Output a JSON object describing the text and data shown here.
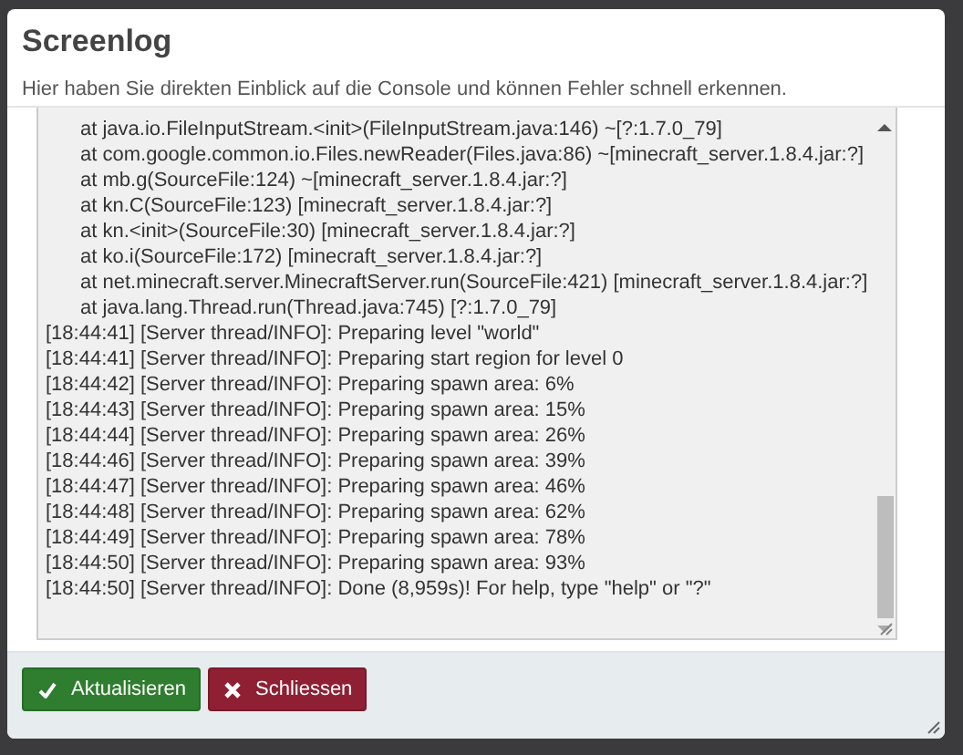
{
  "dialog": {
    "title": "Screenlog",
    "description": "Hier haben Sie direkten Einblick auf die Console und können Fehler schnell erkennen."
  },
  "console": {
    "lines": [
      {
        "kind": "trace",
        "text": "at java.io.FileInputStream.<init>(FileInputStream.java:146) ~[?:1.7.0_79]"
      },
      {
        "kind": "trace",
        "text": "at com.google.common.io.Files.newReader(Files.java:86) ~[minecraft_server.1.8.4.jar:?]"
      },
      {
        "kind": "trace",
        "text": "at mb.g(SourceFile:124) ~[minecraft_server.1.8.4.jar:?]"
      },
      {
        "kind": "trace",
        "text": "at kn.C(SourceFile:123) [minecraft_server.1.8.4.jar:?]"
      },
      {
        "kind": "trace",
        "text": "at kn.<init>(SourceFile:30) [minecraft_server.1.8.4.jar:?]"
      },
      {
        "kind": "trace",
        "text": "at ko.i(SourceFile:172) [minecraft_server.1.8.4.jar:?]"
      },
      {
        "kind": "trace",
        "text": "at net.minecraft.server.MinecraftServer.run(SourceFile:421) [minecraft_server.1.8.4.jar:?]"
      },
      {
        "kind": "trace",
        "text": "at java.lang.Thread.run(Thread.java:745) [?:1.7.0_79]"
      },
      {
        "kind": "log",
        "text": "[18:44:41] [Server thread/INFO]: Preparing level \"world\""
      },
      {
        "kind": "log",
        "text": "[18:44:41] [Server thread/INFO]: Preparing start region for level 0"
      },
      {
        "kind": "log",
        "text": "[18:44:42] [Server thread/INFO]: Preparing spawn area: 6%"
      },
      {
        "kind": "log",
        "text": "[18:44:43] [Server thread/INFO]: Preparing spawn area: 15%"
      },
      {
        "kind": "log",
        "text": "[18:44:44] [Server thread/INFO]: Preparing spawn area: 26%"
      },
      {
        "kind": "log",
        "text": "[18:44:46] [Server thread/INFO]: Preparing spawn area: 39%"
      },
      {
        "kind": "log",
        "text": "[18:44:47] [Server thread/INFO]: Preparing spawn area: 46%"
      },
      {
        "kind": "log",
        "text": "[18:44:48] [Server thread/INFO]: Preparing spawn area: 62%"
      },
      {
        "kind": "log",
        "text": "[18:44:49] [Server thread/INFO]: Preparing spawn area: 78%"
      },
      {
        "kind": "log",
        "text": "[18:44:50] [Server thread/INFO]: Preparing spawn area: 93%"
      },
      {
        "kind": "log",
        "text": "[18:44:50] [Server thread/INFO]: Done (8,959s)! For help, type \"help\" or \"?\""
      }
    ]
  },
  "buttons": [
    {
      "kind": "confirm",
      "label": "Aktualisieren"
    },
    {
      "kind": "cancel",
      "label": "Schliessen"
    }
  ]
}
